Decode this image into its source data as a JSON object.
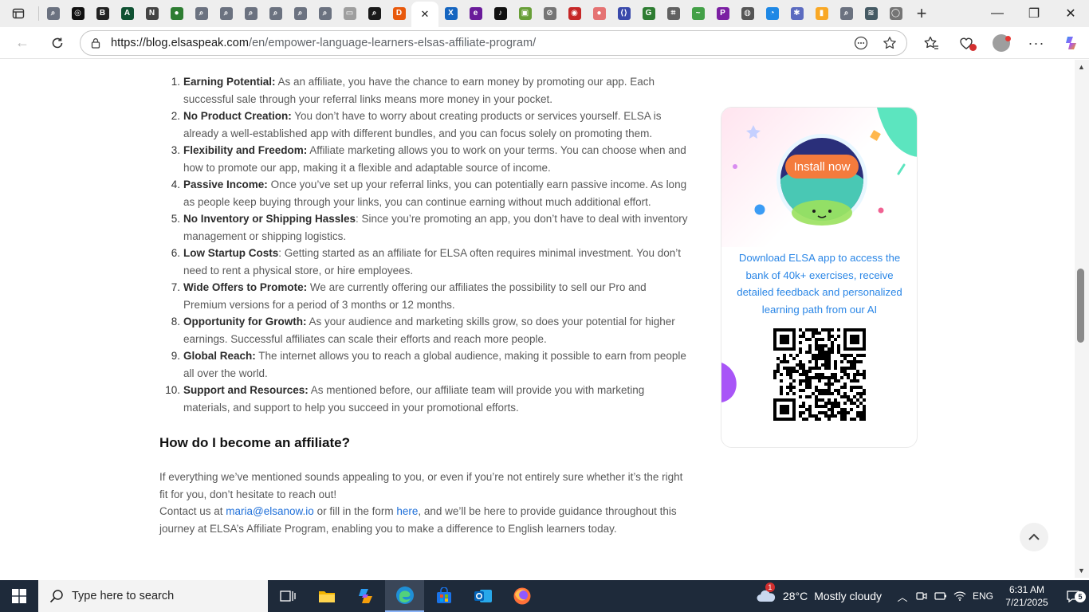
{
  "browser": {
    "url_host": "https://blog.elsaspeak.com",
    "url_path": "/en/empower-language-learners-elsas-affiliate-program/",
    "tabs": [
      {
        "icon": "search-icon",
        "color": "#6b7280",
        "glyph": "⌕"
      },
      {
        "icon": "chatgpt-icon",
        "color": "#111111",
        "glyph": "◎"
      },
      {
        "icon": "bold-b-icon",
        "color": "#222222",
        "glyph": "B"
      },
      {
        "icon": "chart-a-icon",
        "color": "#0f5132",
        "glyph": "A"
      },
      {
        "icon": "notion-icon",
        "color": "#444444",
        "glyph": "N"
      },
      {
        "icon": "green-globe-icon",
        "color": "#2e7d32",
        "glyph": "●"
      },
      {
        "icon": "search-icon",
        "color": "#6b7280",
        "glyph": "⌕"
      },
      {
        "icon": "search-icon",
        "color": "#6b7280",
        "glyph": "⌕"
      },
      {
        "icon": "search-icon",
        "color": "#6b7280",
        "glyph": "⌕"
      },
      {
        "icon": "search-icon",
        "color": "#6b7280",
        "glyph": "⌕"
      },
      {
        "icon": "search-icon",
        "color": "#6b7280",
        "glyph": "⌕"
      },
      {
        "icon": "search-icon",
        "color": "#6b7280",
        "glyph": "⌕"
      },
      {
        "icon": "page-icon",
        "color": "#9e9e9e",
        "glyph": "▭"
      },
      {
        "icon": "search-icon",
        "color": "#1a1a1a",
        "glyph": "⌕"
      },
      {
        "icon": "d-orange-icon",
        "color": "#e8590c",
        "glyph": "D"
      }
    ],
    "tabs_after": [
      {
        "icon": "xf-icon",
        "color": "#1565c0",
        "glyph": "X"
      },
      {
        "icon": "edge-e-icon",
        "color": "#6a1b9a",
        "glyph": "e"
      },
      {
        "icon": "tiktok-icon",
        "color": "#111111",
        "glyph": "♪"
      },
      {
        "icon": "green-square-icon",
        "color": "#689f38",
        "glyph": "▣"
      },
      {
        "icon": "circle-slash-icon",
        "color": "#757575",
        "glyph": "⊘"
      },
      {
        "icon": "red-ring-icon",
        "color": "#c62828",
        "glyph": "◉"
      },
      {
        "icon": "dots-icon",
        "color": "#e57373",
        "glyph": "●"
      },
      {
        "icon": "brackets-icon",
        "color": "#3949ab",
        "glyph": "⟨⟩"
      },
      {
        "icon": "grammarly-icon",
        "color": "#2e7d32",
        "glyph": "G"
      },
      {
        "icon": "puzzle-icon",
        "color": "#616161",
        "glyph": "⌗"
      },
      {
        "icon": "wave-icon",
        "color": "#43a047",
        "glyph": "~"
      },
      {
        "icon": "p-purple-icon",
        "color": "#7b1fa2",
        "glyph": "P"
      },
      {
        "icon": "fingerprint-icon",
        "color": "#555555",
        "glyph": "◍"
      },
      {
        "icon": "blue-circle-icon",
        "color": "#1e88e5",
        "glyph": "◔"
      },
      {
        "icon": "asterisk-icon",
        "color": "#5c6bc0",
        "glyph": "✱"
      },
      {
        "icon": "orange-bar-icon",
        "color": "#f9a825",
        "glyph": "▮"
      },
      {
        "icon": "search-icon",
        "color": "#6b7280",
        "glyph": "⌕"
      },
      {
        "icon": "layers-icon",
        "color": "#455a64",
        "glyph": "≋"
      },
      {
        "icon": "globe-icon",
        "color": "#757575",
        "glyph": "◯"
      }
    ]
  },
  "article": {
    "benefits": [
      {
        "num": "1.",
        "title": "Earning Potential:",
        "text": " As an affiliate, you have the chance to earn money by promoting our app. Each successful sale through your referral links means more money in your pocket."
      },
      {
        "num": "2.",
        "title": "No Product Creation:",
        "text": " You don’t have to worry about creating products or services yourself. ELSA is already a well-established app with different bundles, and you can focus solely on promoting them."
      },
      {
        "num": "3.",
        "title": "Flexibility and Freedom:",
        "text": " Affiliate marketing allows you to work on your terms. You can choose when and how to promote our app, making it a flexible and adaptable source of income."
      },
      {
        "num": "4.",
        "title": "Passive Income:",
        "text": " Once you’ve set up your referral links, you can potentially earn passive income. As long as people keep buying through your links, you can continue earning without much additional effort."
      },
      {
        "num": "5.",
        "title": "No Inventory or Shipping Hassles",
        "text": ": Since you’re promoting an app, you don’t have to deal with inventory management or shipping logistics."
      },
      {
        "num": "6.",
        "title": "Low Startup Costs",
        "text": ": Getting started as an affiliate for ELSA often requires minimal investment. You don’t need to rent a physical store, or hire employees."
      },
      {
        "num": "7.",
        "title": "Wide Offers to Promote:",
        "text": " We are currently offering our affiliates the possibility to sell our Pro and Premium versions for a period of 3 months or 12 months."
      },
      {
        "num": "8.",
        "title": "Opportunity for Growth:",
        "text": " As your audience and marketing skills grow, so does your potential for higher earnings. Successful affiliates can scale their efforts and reach more people."
      },
      {
        "num": "9.",
        "title": "Global Reach:",
        "text": " The internet allows you to reach a global audience, making it possible to earn from people all over the world."
      },
      {
        "num": "10.",
        "title": "Support and Resources:",
        "text": " As mentioned before, our affiliate team will provide you with marketing materials, and support to help you succeed in your promotional efforts."
      }
    ],
    "heading": "How do I become an affiliate?",
    "para1": "If everything we’ve mentioned sounds appealing to you, or even if you’re not entirely sure whether it’s the right fit for you, don’t hesitate to reach out!",
    "para2_prefix": "Contact us at ",
    "email": "maria@elsanow.io",
    "para2_mid": " or fill in the form ",
    "form_link": "here",
    "para2_suffix": ", and we’ll be here to provide guidance throughout this journey at ELSA’s Affiliate Program, enabling you to make a difference to English learners today."
  },
  "promo": {
    "install_label": "Install now",
    "description": "Download ELSA app to access the bank of 40k+ exercises, receive detailed feedback and personalized learning path from our AI"
  },
  "taskbar": {
    "search_placeholder": "Type here to search",
    "weather_temp": "28°C",
    "weather_desc": "Mostly cloudy",
    "weather_badge": "1",
    "language": "ENG",
    "time": "6:31 AM",
    "date": "7/21/2025",
    "notification_count": "5"
  },
  "colors": {
    "link": "#1e6fd9",
    "promo_text": "#2a86e6",
    "install_orange": "#f47b3d",
    "taskbar": "#1e2a3a"
  }
}
